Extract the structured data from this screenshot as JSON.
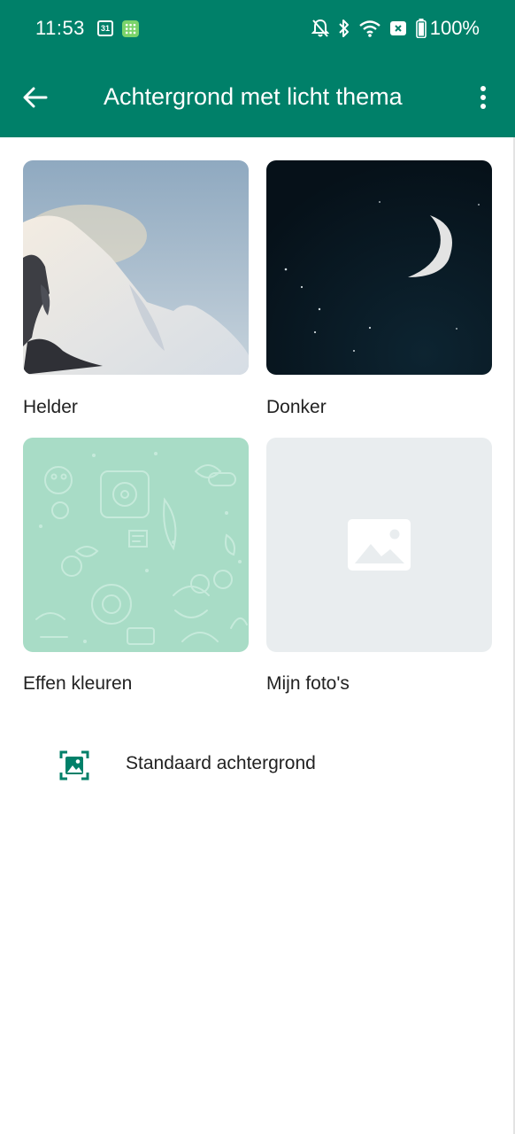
{
  "status_bar": {
    "time": "11:53",
    "calendar_day": "31",
    "battery": "100%"
  },
  "header": {
    "title": "Achtergrond met licht thema"
  },
  "wallpapers": [
    {
      "label": "Helder"
    },
    {
      "label": "Donker"
    },
    {
      "label": "Effen kleuren"
    },
    {
      "label": "Mijn foto's"
    }
  ],
  "default_option": {
    "label": "Standaard achtergrond"
  },
  "colors": {
    "brand": "#008069",
    "solid_tile": "#a8dcc6",
    "photo_tile": "#e9edef"
  }
}
